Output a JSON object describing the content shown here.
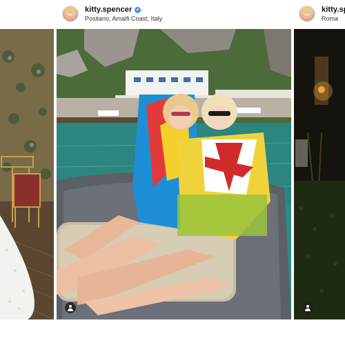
{
  "posts": [
    {
      "username": "",
      "location": "",
      "photo_alt": ""
    },
    {
      "username": "kitty.spencer",
      "verified": true,
      "location": "Positano, Amalfi Coast, Italy"
    },
    {
      "username": "kitty.sp",
      "location": "Roma"
    }
  ],
  "icons": {
    "avatar": "avatar",
    "verified": "verified-badge-icon",
    "user_tag": "user-tag-icon"
  },
  "colors": {
    "verified": "#3897f0",
    "sea": "#2f8b86",
    "boat": "#5b5f66"
  }
}
